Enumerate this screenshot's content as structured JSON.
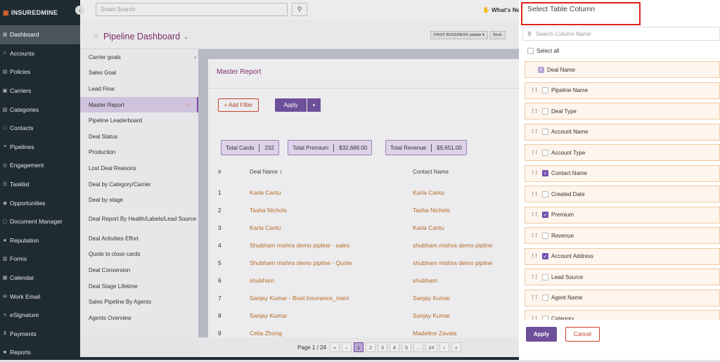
{
  "app": {
    "logo": "INSUREDMINE"
  },
  "sidebar": {
    "items": [
      {
        "label": "Dashboard",
        "icon": "dashboard-icon",
        "active": true
      },
      {
        "label": "Accounts",
        "icon": "accounts-icon"
      },
      {
        "label": "Policies",
        "icon": "policies-icon"
      },
      {
        "label": "Carriers",
        "icon": "carriers-icon"
      },
      {
        "label": "Categories",
        "icon": "categories-icon"
      },
      {
        "label": "Contacts",
        "icon": "contacts-icon"
      },
      {
        "label": "Pipelines",
        "icon": "pipelines-icon"
      },
      {
        "label": "Engagement",
        "icon": "engagement-icon"
      },
      {
        "label": "Tasklist",
        "icon": "tasklist-icon"
      },
      {
        "label": "Opportunities",
        "icon": "opportunities-icon"
      },
      {
        "label": "Document Manager",
        "icon": "document-icon"
      },
      {
        "label": "Reputation",
        "icon": "reputation-icon"
      },
      {
        "label": "Forms",
        "icon": "forms-icon"
      },
      {
        "label": "Calendar",
        "icon": "calendar-icon"
      },
      {
        "label": "Work Email",
        "icon": "email-icon"
      },
      {
        "label": "eSignature",
        "icon": "signature-icon"
      },
      {
        "label": "Payments",
        "icon": "payments-icon"
      },
      {
        "label": "Reports",
        "icon": "reports-icon"
      }
    ]
  },
  "topbar": {
    "search_placeholder": "Smart Search",
    "whats_new": "What's Ne"
  },
  "dashboard": {
    "title": "Pipeline Dashboard",
    "select1": "FRUIT BUSSINESS update",
    "select2": "Shub"
  },
  "reports": {
    "items": [
      {
        "label": "Carrier goals"
      },
      {
        "label": "Sales Goal"
      },
      {
        "label": "Lead Flow"
      },
      {
        "label": "Master Report",
        "active": true
      },
      {
        "label": "Pipeline Leaderboard"
      },
      {
        "label": "Deal Status"
      },
      {
        "label": "Production"
      },
      {
        "label": "Lost Deal Reasons"
      },
      {
        "label": "Deal by Category/Carrier"
      },
      {
        "label": "Deal by stage"
      },
      {
        "label": "Deal Report By Health/Labels/Lead Source"
      },
      {
        "label": "Deal Activities Effort"
      },
      {
        "label": "Quote to close cards"
      },
      {
        "label": "Deal Conversion"
      },
      {
        "label": "Deal Stage Lifetime"
      },
      {
        "label": "Sales Pipeline By Agents"
      },
      {
        "label": "Agents Overview"
      }
    ]
  },
  "master_report": {
    "title": "Master Report",
    "add_filter": "+ Add Filter",
    "apply": "Apply",
    "totals": [
      {
        "label": "Total Cards",
        "value": "232"
      },
      {
        "label": "Total Premium",
        "value": "$32,688.00"
      },
      {
        "label": "Total Revenue",
        "value": "$9,651.00"
      }
    ],
    "columns": [
      "#",
      "Deal Name ↕",
      "Contact Name"
    ],
    "rows": [
      {
        "n": "1",
        "deal": "Karla Cantu",
        "contact": "Karla Cantu"
      },
      {
        "n": "2",
        "deal": "Tasha Nichols",
        "contact": "Tasha Nichols"
      },
      {
        "n": "3",
        "deal": "Karla Cantu",
        "contact": "Karla Cantu"
      },
      {
        "n": "4",
        "deal": "Shubham mishra demo pipline - sales",
        "contact": "shubham mishra demo pipline"
      },
      {
        "n": "5",
        "deal": "Shubham mishra demo pipline - Quote",
        "contact": "shubham mishra demo pipline"
      },
      {
        "n": "6",
        "deal": "shubham",
        "contact": "shubham"
      },
      {
        "n": "7",
        "deal": "Sanjay Kumar - Boat Insurance_mani",
        "contact": "Sanjay Kumar"
      },
      {
        "n": "8",
        "deal": "Sanjay Kumar",
        "contact": "Sanjay Kumar"
      },
      {
        "n": "9",
        "deal": "Celia Zhong",
        "contact": "Madeline Zavala"
      }
    ]
  },
  "pagination": {
    "label": "Page 1 / 24",
    "first": "«",
    "prev": "‹",
    "pages": [
      "1",
      "2",
      "3",
      "4",
      "5",
      "...",
      "24"
    ],
    "current": "1",
    "next": "›",
    "last": "»"
  },
  "column_panel": {
    "title": "Select Table Column",
    "search_placeholder": "Search Column Name",
    "select_all": "Select all",
    "columns": [
      {
        "label": "Deal Name",
        "checked": true,
        "locked": true
      },
      {
        "label": "Pipeline Name",
        "checked": false
      },
      {
        "label": "Deal Type",
        "checked": false
      },
      {
        "label": "Account Name",
        "checked": false
      },
      {
        "label": "Account Type",
        "checked": false
      },
      {
        "label": "Contact Name",
        "checked": true
      },
      {
        "label": "Created Date",
        "checked": false
      },
      {
        "label": "Premium",
        "checked": true
      },
      {
        "label": "Revenue",
        "checked": false
      },
      {
        "label": "Account Address",
        "checked": true
      },
      {
        "label": "Lead Source",
        "checked": false
      },
      {
        "label": "Agent Name",
        "checked": false
      },
      {
        "label": "Category",
        "checked": false
      }
    ],
    "apply": "Apply",
    "cancel": "Cancel"
  },
  "colors": {
    "brand_purple": "#6e4f99",
    "deal_link": "#b46a28",
    "highlight_red": "#e0241b",
    "sidebar_bg": "#1f2b32"
  }
}
